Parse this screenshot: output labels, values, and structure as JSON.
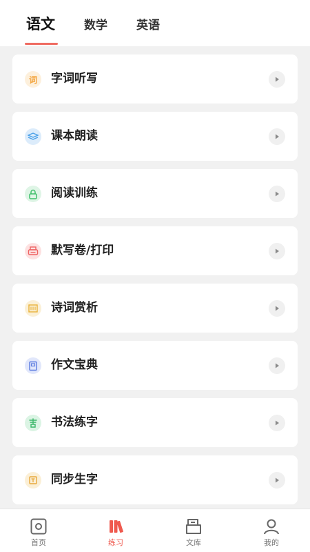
{
  "tabs": [
    {
      "label": "语文",
      "active": true
    },
    {
      "label": "数学",
      "active": false
    },
    {
      "label": "英语",
      "active": false
    }
  ],
  "items": [
    {
      "label": "字词听写",
      "icon": "character-icon",
      "color": "#f3a33b",
      "bg": "#fdf0dc"
    },
    {
      "label": "课本朗读",
      "icon": "book-icon",
      "color": "#4aa0e8",
      "bg": "#dcecfb"
    },
    {
      "label": "阅读训练",
      "icon": "lock-icon",
      "color": "#3fbf6a",
      "bg": "#dff5e6"
    },
    {
      "label": "默写卷/打印",
      "icon": "printer-icon",
      "color": "#ee6262",
      "bg": "#fde1e1"
    },
    {
      "label": "诗词赏析",
      "icon": "scroll-icon",
      "color": "#e8b23a",
      "bg": "#fbf0d6"
    },
    {
      "label": "作文宝典",
      "icon": "notebook-icon",
      "color": "#5b7be0",
      "bg": "#e1e7fb"
    },
    {
      "label": "书法练字",
      "icon": "calligraphy-icon",
      "color": "#3bb76a",
      "bg": "#dbf4e4"
    },
    {
      "label": "同步生字",
      "icon": "tile-icon",
      "color": "#e8a83a",
      "bg": "#fbefd6"
    }
  ],
  "nav": [
    {
      "label": "首页",
      "icon": "home-icon",
      "active": false
    },
    {
      "label": "练习",
      "icon": "practice-icon",
      "active": true
    },
    {
      "label": "文库",
      "icon": "library-icon",
      "active": false
    },
    {
      "label": "我的",
      "icon": "profile-icon",
      "active": false
    }
  ],
  "colors": {
    "accent": "#ef5a4f"
  }
}
